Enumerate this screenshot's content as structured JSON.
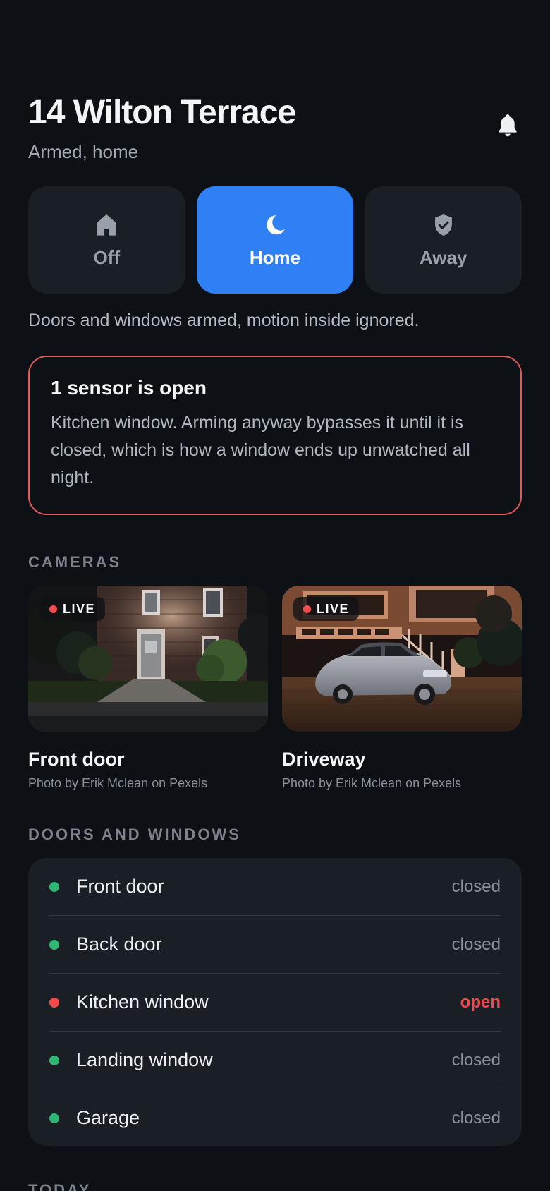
{
  "header": {
    "title": "14 Wilton Terrace",
    "subtitle": "Armed, home"
  },
  "modes": [
    {
      "label": "Off",
      "icon": "house-icon",
      "active": false
    },
    {
      "label": "Home",
      "icon": "moon-icon",
      "active": true
    },
    {
      "label": "Away",
      "icon": "shield-check-icon",
      "active": false
    }
  ],
  "mode_description": "Doors and windows armed, motion inside ignored.",
  "alert": {
    "title": "1 sensor is open",
    "body": "Kitchen window. Arming anyway bypasses it until it is closed, which is how a window ends up unwatched all night.",
    "border_color": "#e05a5a"
  },
  "cameras": {
    "section_label": "CAMERAS",
    "items": [
      {
        "name": "Front door",
        "credit": "Photo by Erik Mclean on Pexels",
        "badge": "LIVE"
      },
      {
        "name": "Driveway",
        "credit": "Photo by Erik Mclean on Pexels",
        "badge": "LIVE"
      }
    ]
  },
  "doors_windows": {
    "section_label": "DOORS AND WINDOWS",
    "items": [
      {
        "name": "Front door",
        "status": "closed",
        "dot_color": "#2fb574"
      },
      {
        "name": "Back door",
        "status": "closed",
        "dot_color": "#2fb574"
      },
      {
        "name": "Kitchen window",
        "status": "open",
        "dot_color": "#ef4b4b"
      },
      {
        "name": "Landing window",
        "status": "closed",
        "dot_color": "#2fb574"
      },
      {
        "name": "Garage",
        "status": "closed",
        "dot_color": "#2fb574"
      }
    ]
  },
  "today": {
    "section_label": "TODAY"
  },
  "colors": {
    "accent": "#2f80f5",
    "background": "#0d1014",
    "card": "#1a1e25",
    "ok": "#2fb574",
    "alert": "#ef4b4b"
  }
}
